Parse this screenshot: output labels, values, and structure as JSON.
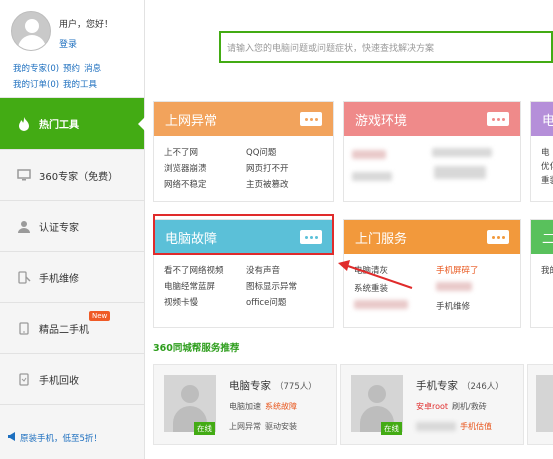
{
  "user": {
    "greeting": "用户，您好！",
    "login": "登录",
    "links_row1": [
      "我的专家(0)",
      "预约",
      "消息"
    ],
    "links_row2": [
      "我的订单(0)",
      "我的工具"
    ]
  },
  "sidebar": {
    "items": [
      {
        "label": "热门工具",
        "icon": "fire-icon",
        "active": true
      },
      {
        "label": "360专家（免费）",
        "icon": "monitor-icon"
      },
      {
        "label": "认证专家",
        "icon": "person-icon"
      },
      {
        "label": "手机维修",
        "icon": "phone-repair-icon"
      },
      {
        "label": "精品二手机",
        "icon": "phone-icon",
        "badge": "New"
      },
      {
        "label": "手机回收",
        "icon": "phone-recycle-icon"
      }
    ],
    "promo": "原装手机，低至5折！"
  },
  "search": {
    "placeholder": "请输入您的电脑问题或问题症状，快速查找解决方案"
  },
  "cards": {
    "internet": {
      "title": "上网异常",
      "color": "#f2a35c",
      "items": [
        "上不了网",
        "QQ问题",
        "浏览器崩溃",
        "网页打不开",
        "网络不稳定",
        "主页被篡改"
      ]
    },
    "game": {
      "title": "游戏环境",
      "color": "#ef8a8a"
    },
    "pc": {
      "title": "电脑故障",
      "color": "#5bc0d8",
      "items": [
        "看不了网络视频",
        "没有声音",
        "电脑经常蓝屏",
        "图标显示异常",
        "视频卡慢",
        "office问题"
      ]
    },
    "onsite": {
      "title": "上门服务",
      "color": "#f2993c",
      "items": [
        "电脑清灰",
        "手机屏碎了",
        "系统重装",
        "手机维修"
      ]
    },
    "purple": {
      "title": "电",
      "color": "#b58fd9",
      "items": [
        "电",
        "优化",
        "重装"
      ]
    },
    "green": {
      "title": "二",
      "color": "#59c15c",
      "items": [
        "我的"
      ]
    }
  },
  "section_title": "360同城帮服务推荐",
  "services": [
    {
      "name": "电脑专家",
      "count": "（775人）",
      "online": "在线",
      "tags1": [
        "电脑加速",
        "系统故障"
      ],
      "tags2": [
        "上网异常",
        "驱动安装"
      ]
    },
    {
      "name": "手机专家",
      "count": "（246人）",
      "online": "在线",
      "tags1": [
        "安卓root",
        "刷机/救砖"
      ],
      "tags2": [
        "手机估值"
      ]
    }
  ]
}
